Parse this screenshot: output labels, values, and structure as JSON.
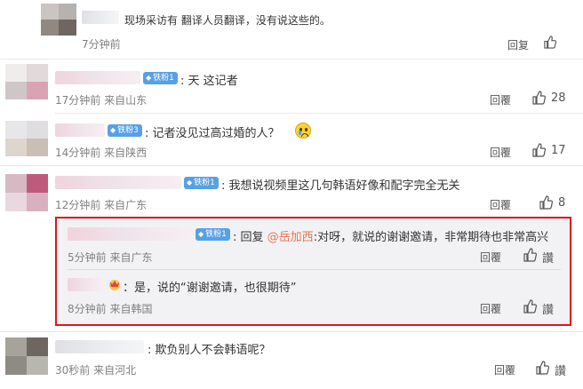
{
  "comments": [
    {
      "text": "现场采访有 翻译人员翻译，没有说这些的。",
      "time": "7分钟前",
      "reply_label": "回复"
    },
    {
      "badge": "铁粉1",
      "text": "天 这记者",
      "time": "17分钟前",
      "location": "来自山东",
      "reply_label": "回覆",
      "likes": "28"
    },
    {
      "badge": "铁粉3",
      "text": "记者没见过高过婚的人？",
      "time": "14分钟前",
      "location": "来自陕西",
      "reply_label": "回覆",
      "likes": "17"
    },
    {
      "badge": "铁粉1",
      "text": "我想说视频里这几句韩语好像和配字完全无关",
      "time": "12分钟前",
      "location": "来自广东",
      "reply_label": "回覆",
      "likes": "8"
    },
    {
      "text": "欺负别人不会韩语呢？",
      "time": "30秒前",
      "location": "来自河北",
      "reply_label": "回覆",
      "likes": "讚"
    }
  ],
  "replies": [
    {
      "badge": "铁粉1",
      "prefix": "回复",
      "mention": "@岳加西",
      "text": ":对呀，就说的谢谢邀请，非常期待也非常高兴",
      "time": "5分钟前",
      "location": "来自广东",
      "reply_label": "回覆",
      "likes": "讚"
    },
    {
      "text": "：是，说的“谢谢邀请，也很期待”",
      "time": "8分钟前",
      "location": "来自韩国",
      "reply_label": "回覆",
      "likes": "讚"
    }
  ],
  "colors": {
    "highlight_border": "#e0141e",
    "badge": "#58a0e6",
    "mention": "#eb7350",
    "meta": "#808080"
  }
}
